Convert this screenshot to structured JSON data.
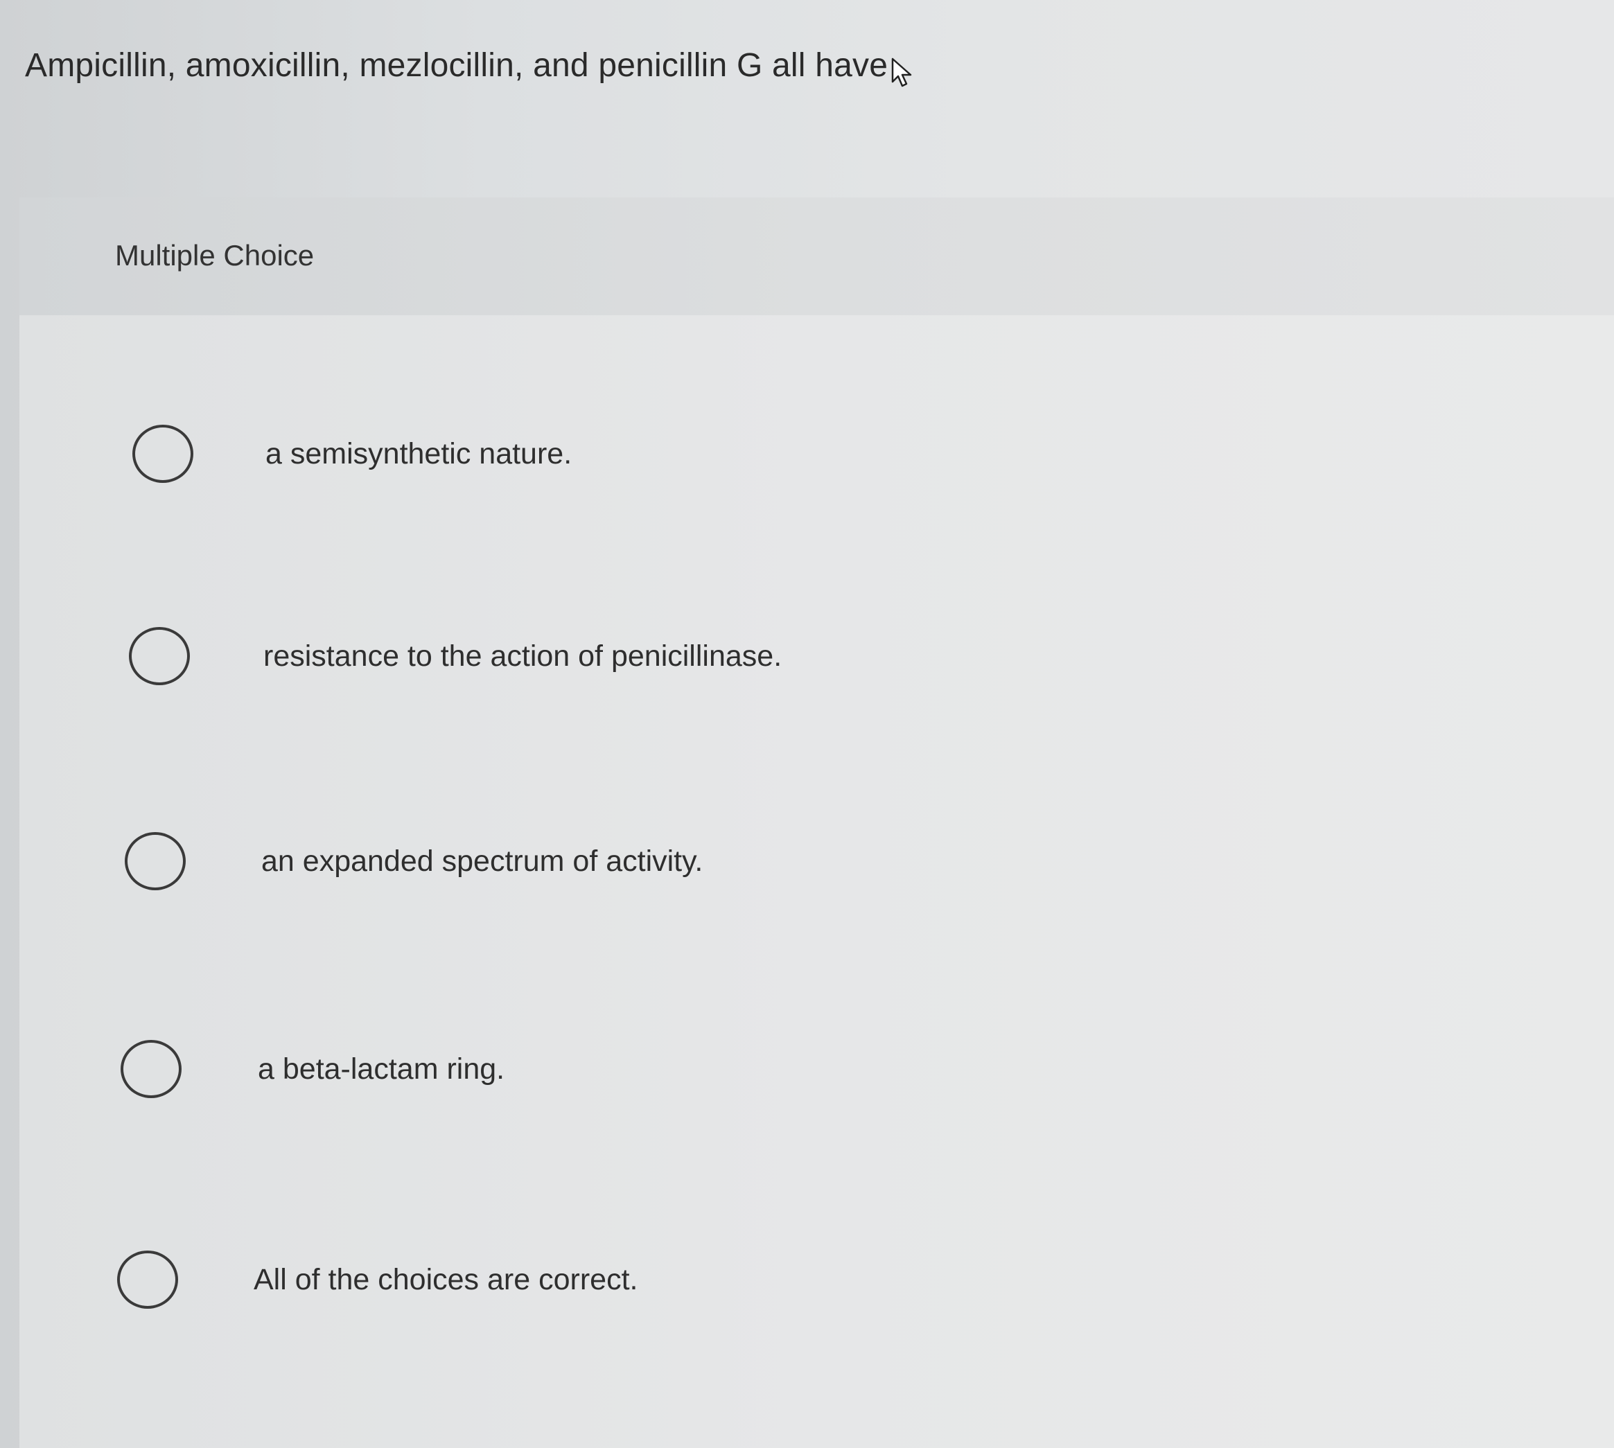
{
  "question": {
    "text": "Ampicillin, amoxicillin, mezlocillin, and penicillin G all have"
  },
  "panel": {
    "title": "Multiple Choice"
  },
  "choices": [
    {
      "label": "a semisynthetic nature."
    },
    {
      "label": "resistance to the action of penicillinase."
    },
    {
      "label": "an expanded spectrum of activity."
    },
    {
      "label": "a beta-lactam ring."
    },
    {
      "label": "All of the choices are correct."
    }
  ],
  "icons": {
    "cursor": "mouse-pointer-icon",
    "radio": "radio-button-icon"
  }
}
